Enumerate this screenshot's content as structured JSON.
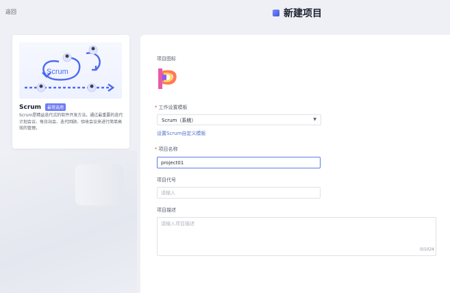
{
  "nav": {
    "back_label": "返回"
  },
  "header": {
    "title": "新建项目"
  },
  "template_card": {
    "illustration_text": "Scrum",
    "name": "Scrum",
    "badge": "最常选用",
    "description": "Scrum是精益迭代式的软件开发方法。通过最重要的迭代计划会议、每日站会、迭代回顾、验收会议来进行简单高效的管理。"
  },
  "form": {
    "icon_label": "项目图标",
    "template_label": "工作设置模板",
    "template_value": "Scrum（系统）",
    "template_link": "设置Scrum自定义模板",
    "name_label": "项目名称",
    "name_value": "project01",
    "code_label": "项目代号",
    "code_placeholder": "请输入",
    "desc_label": "项目描述",
    "desc_placeholder": "请输入项目描述",
    "desc_counter": "0/1024"
  },
  "colors": {
    "accent": "#5e7ce0",
    "link": "#526ecc",
    "required": "#e54545",
    "badge": "#6e7cf2"
  }
}
